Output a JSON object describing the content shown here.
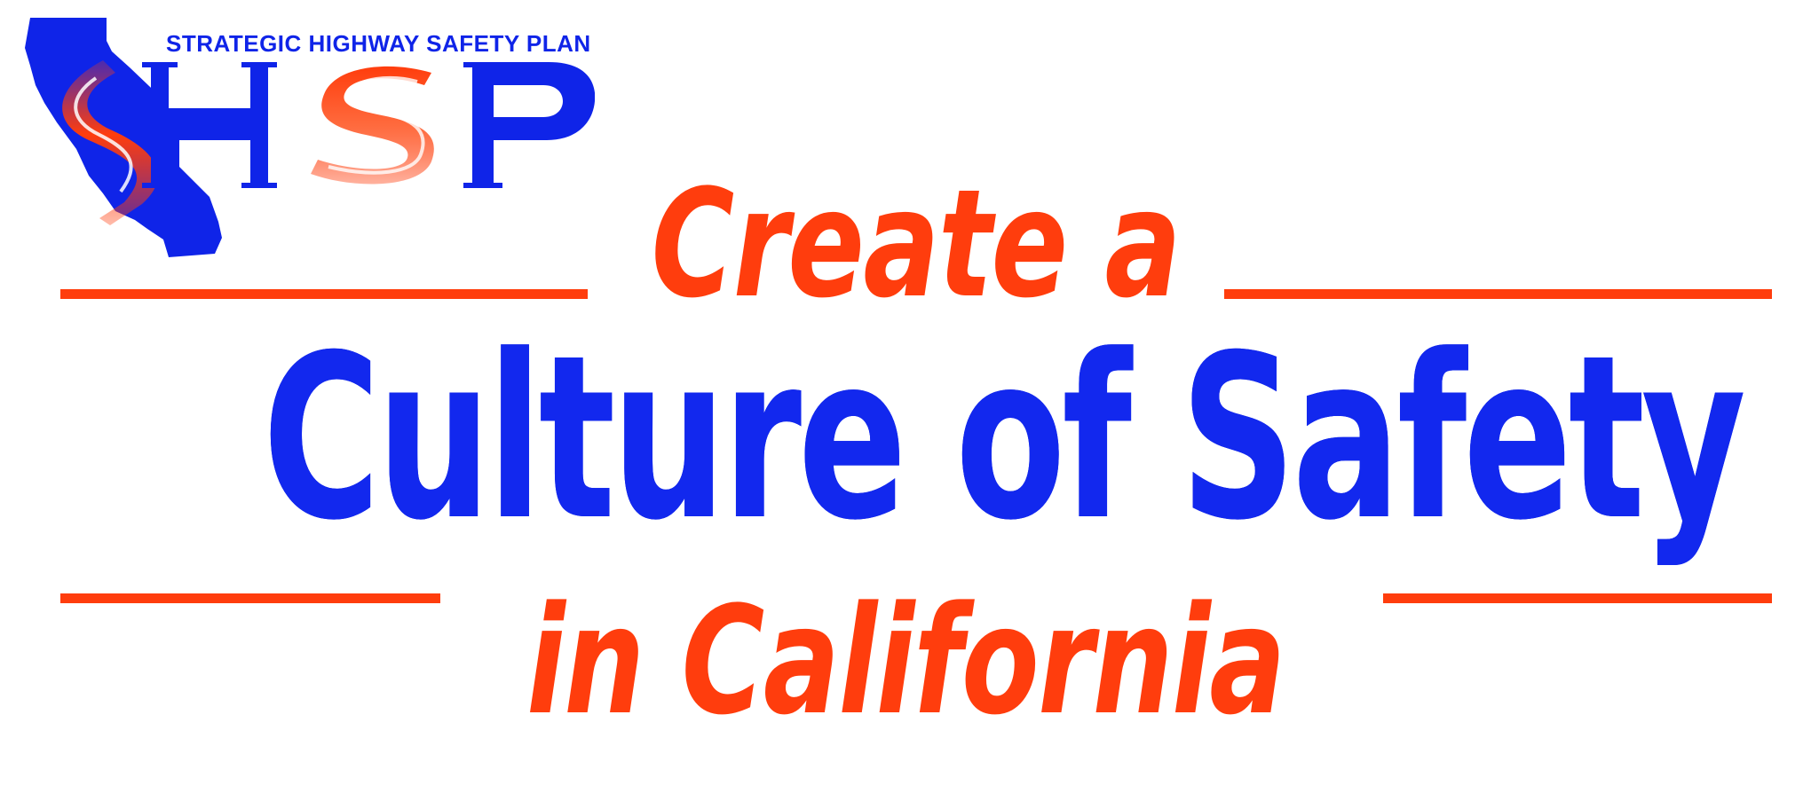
{
  "logo": {
    "tagline": "STRATEGIC HIGHWAY SAFETY PLAN",
    "wordmark": "SHSP",
    "colors": {
      "blue": "#0f24e8",
      "orange": "#ff3d0d"
    }
  },
  "headline": {
    "line1": "Create a",
    "line2": "Culture of Safety",
    "line3": "in California"
  },
  "colors": {
    "orange": "#ff3d0d",
    "blue": "#1228ee",
    "background": "#ffffff"
  }
}
